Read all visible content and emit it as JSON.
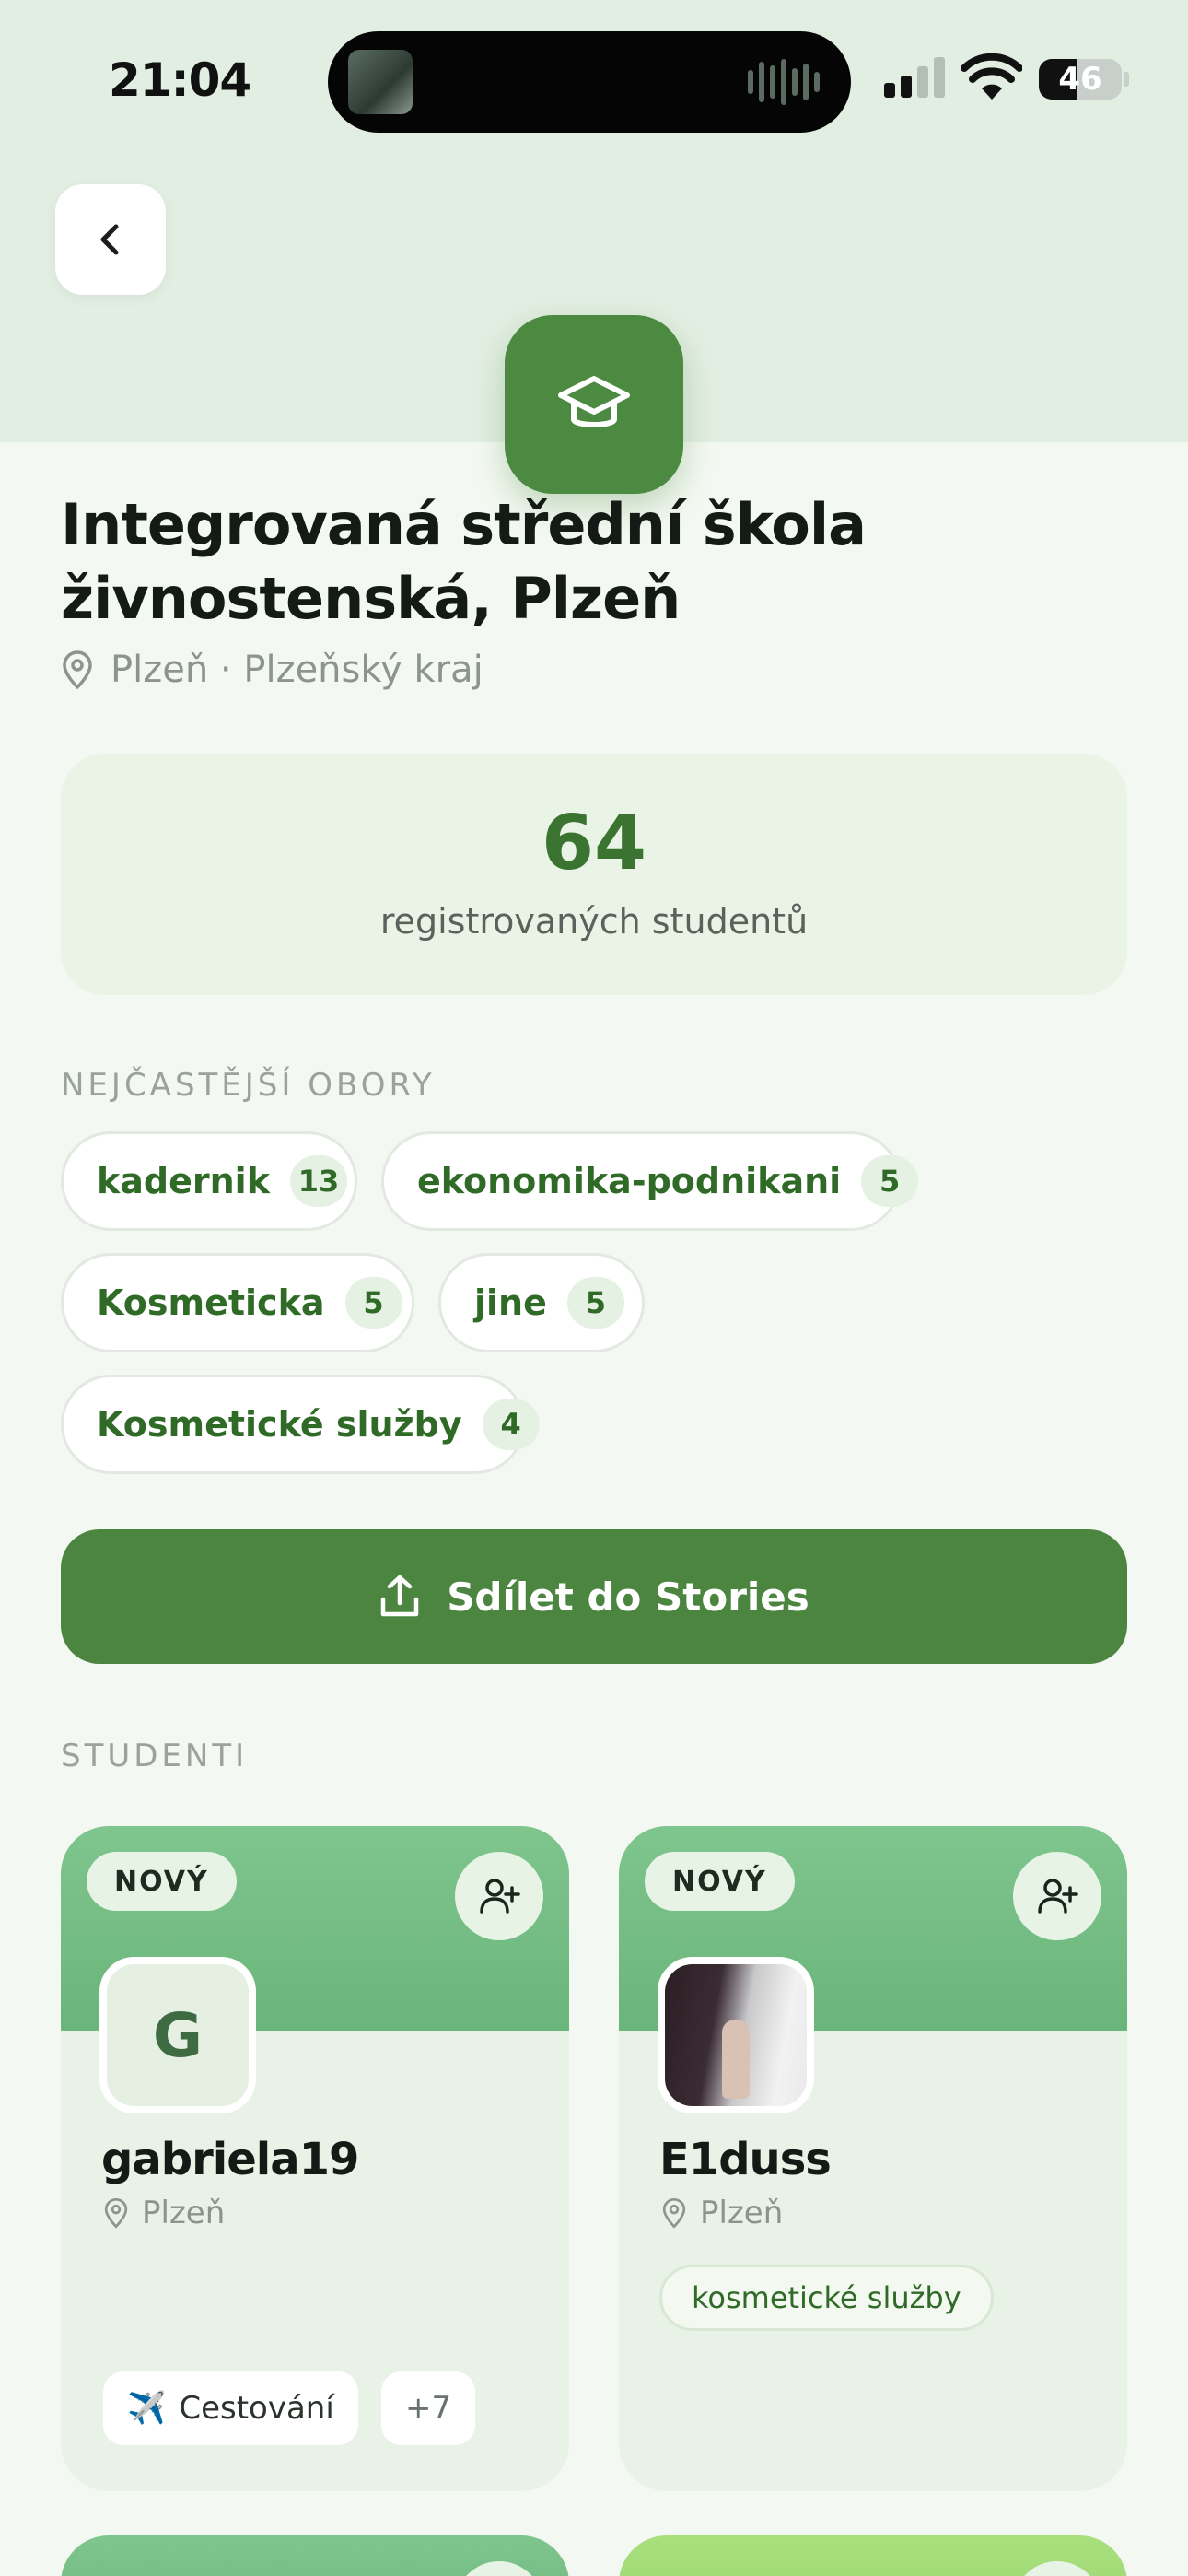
{
  "status_bar": {
    "time": "21:04",
    "battery": "46"
  },
  "school": {
    "name": "Integrovaná střední škola živnostenská, Plzeň",
    "name_line1": "Integrovaná střední škola",
    "name_line2": "živnostenská, Plzeň",
    "location": "Plzeň · Plzeňský kraj"
  },
  "stats": {
    "count": "64",
    "label": "registrovaných studentů"
  },
  "fields": {
    "heading": "NEJČASTĚJŠÍ OBORY",
    "items": [
      {
        "name": "kadernik",
        "count": "13"
      },
      {
        "name": "ekonomika-podnikani",
        "count": "5"
      },
      {
        "name": "Kosmeticka",
        "count": "5"
      },
      {
        "name": "jine",
        "count": "5"
      },
      {
        "name": "Kosmetické služby",
        "count": "4"
      }
    ]
  },
  "share": {
    "label": "Sdílet do Stories"
  },
  "students": {
    "heading": "STUDENTI",
    "items": [
      {
        "badge": "NOVÝ",
        "initial": "G",
        "username": "gabriela19",
        "location": "Plzeň",
        "tags": [
          {
            "icon": "✈️",
            "label": "Cestování"
          }
        ],
        "more": "+7"
      },
      {
        "badge": "NOVÝ",
        "username": "E1duss",
        "location": "Plzeň",
        "field": "kosmetické služby"
      }
    ]
  },
  "colors": {
    "accent": "#4b853f",
    "accent_light": "#e5f1e2",
    "header": "#e2eee2",
    "background": "#f4f8f2"
  }
}
